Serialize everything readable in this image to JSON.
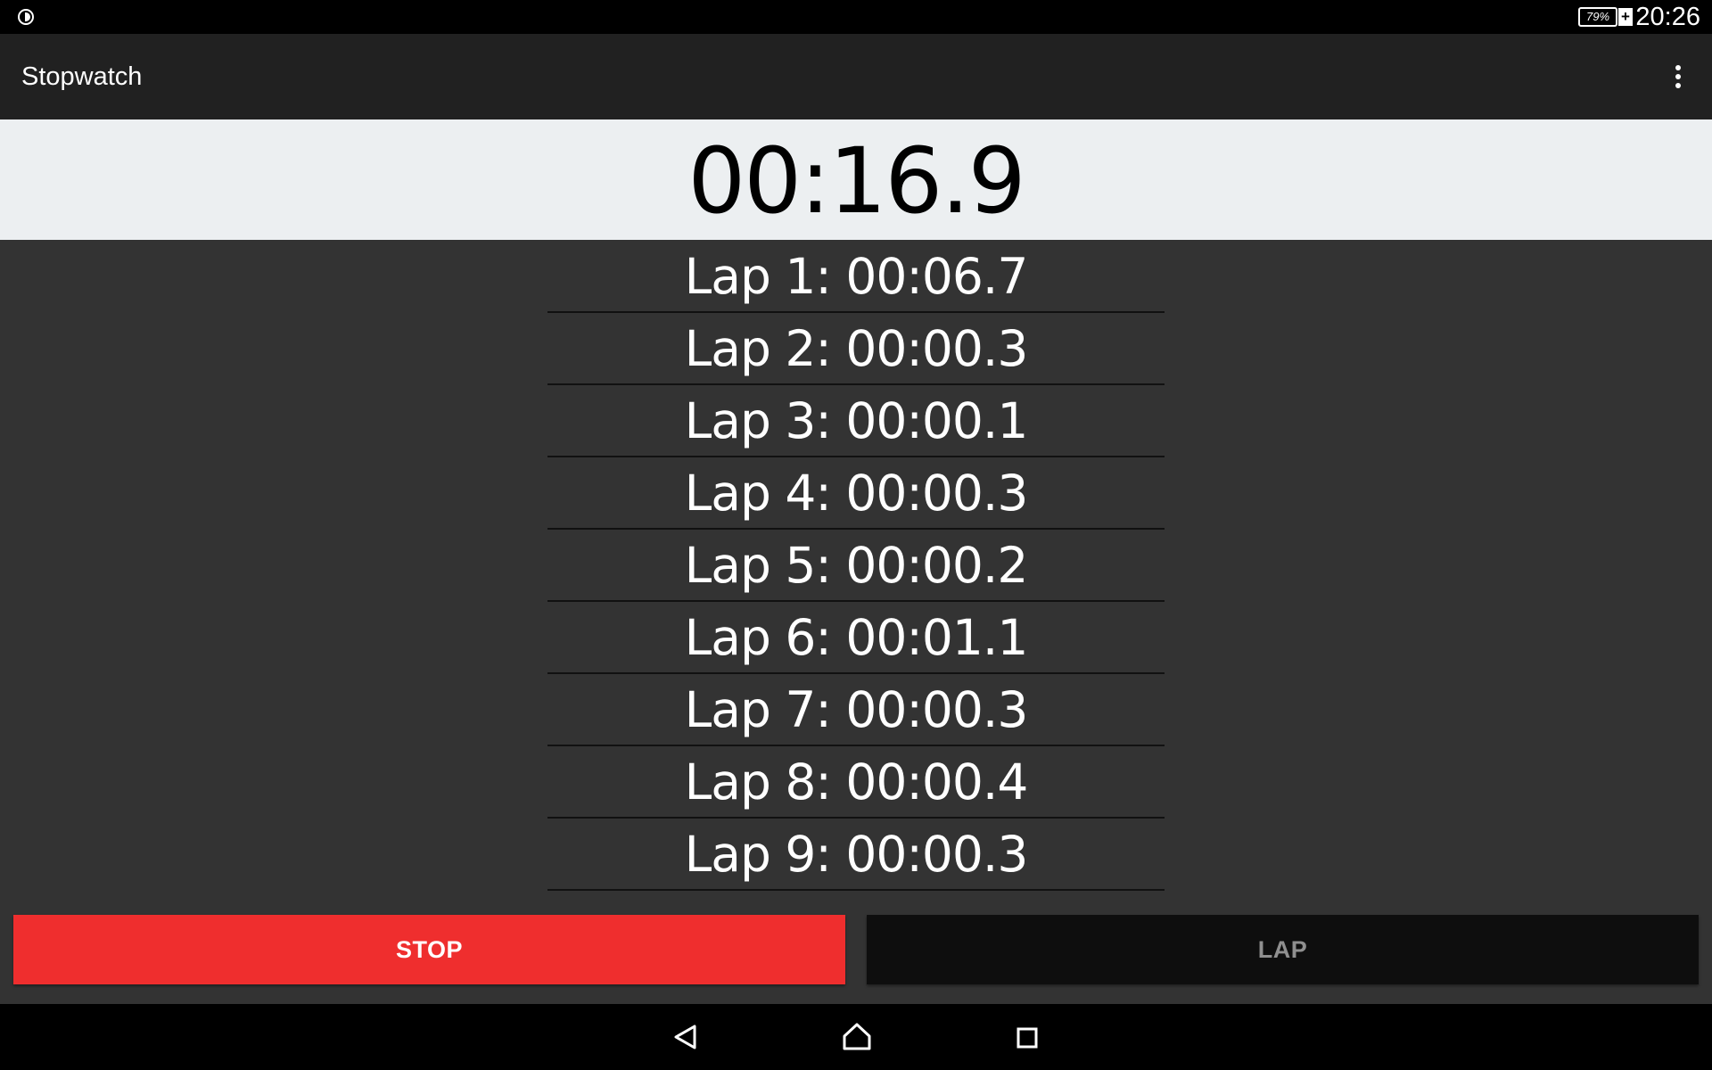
{
  "status_bar": {
    "battery_percent": "79%",
    "time": "20:26",
    "left_icon": "data-saver-icon"
  },
  "app_bar": {
    "title": "Stopwatch",
    "overflow_icon": "more-vert-icon"
  },
  "timer": {
    "value": "00:16.9"
  },
  "laps": [
    "Lap 1: 00:06.7",
    "Lap 2: 00:00.3",
    "Lap 3: 00:00.1",
    "Lap 4: 00:00.3",
    "Lap 5: 00:00.2",
    "Lap 6: 00:01.1",
    "Lap 7: 00:00.3",
    "Lap 8: 00:00.4",
    "Lap 9: 00:00.3"
  ],
  "buttons": {
    "stop_label": "STOP",
    "lap_label": "LAP",
    "stop_color": "#ef2e2e",
    "lap_color": "#0e0e0e"
  },
  "nav_bar": {
    "back_icon": "back-icon",
    "home_icon": "home-icon",
    "recents_icon": "recents-icon"
  }
}
